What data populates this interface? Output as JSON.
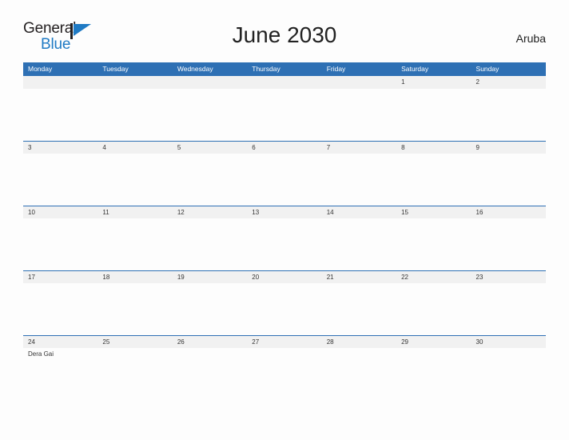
{
  "brand": {
    "name_part1": "General",
    "name_part2": "Blue",
    "flag_icon": "flag-triangle-icon",
    "accent_color": "#1f7ac4"
  },
  "header": {
    "title": "June 2030",
    "country": "Aruba"
  },
  "colors": {
    "header_blue": "#2e70b4",
    "date_strip_gray": "#f1f1f1",
    "page_background": "#fdfdfd",
    "text_dark": "#333333"
  },
  "calendar": {
    "month": "June",
    "year": "2030",
    "weekdays": [
      "Monday",
      "Tuesday",
      "Wednesday",
      "Thursday",
      "Friday",
      "Saturday",
      "Sunday"
    ],
    "weeks": [
      {
        "days": [
          {
            "date": "",
            "event": ""
          },
          {
            "date": "",
            "event": ""
          },
          {
            "date": "",
            "event": ""
          },
          {
            "date": "",
            "event": ""
          },
          {
            "date": "",
            "event": ""
          },
          {
            "date": "1",
            "event": ""
          },
          {
            "date": "2",
            "event": ""
          }
        ]
      },
      {
        "days": [
          {
            "date": "3",
            "event": ""
          },
          {
            "date": "4",
            "event": ""
          },
          {
            "date": "5",
            "event": ""
          },
          {
            "date": "6",
            "event": ""
          },
          {
            "date": "7",
            "event": ""
          },
          {
            "date": "8",
            "event": ""
          },
          {
            "date": "9",
            "event": ""
          }
        ]
      },
      {
        "days": [
          {
            "date": "10",
            "event": ""
          },
          {
            "date": "11",
            "event": ""
          },
          {
            "date": "12",
            "event": ""
          },
          {
            "date": "13",
            "event": ""
          },
          {
            "date": "14",
            "event": ""
          },
          {
            "date": "15",
            "event": ""
          },
          {
            "date": "16",
            "event": ""
          }
        ]
      },
      {
        "days": [
          {
            "date": "17",
            "event": ""
          },
          {
            "date": "18",
            "event": ""
          },
          {
            "date": "19",
            "event": ""
          },
          {
            "date": "20",
            "event": ""
          },
          {
            "date": "21",
            "event": ""
          },
          {
            "date": "22",
            "event": ""
          },
          {
            "date": "23",
            "event": ""
          }
        ]
      },
      {
        "days": [
          {
            "date": "24",
            "event": "Dera Gai"
          },
          {
            "date": "25",
            "event": ""
          },
          {
            "date": "26",
            "event": ""
          },
          {
            "date": "27",
            "event": ""
          },
          {
            "date": "28",
            "event": ""
          },
          {
            "date": "29",
            "event": ""
          },
          {
            "date": "30",
            "event": ""
          }
        ]
      }
    ]
  }
}
